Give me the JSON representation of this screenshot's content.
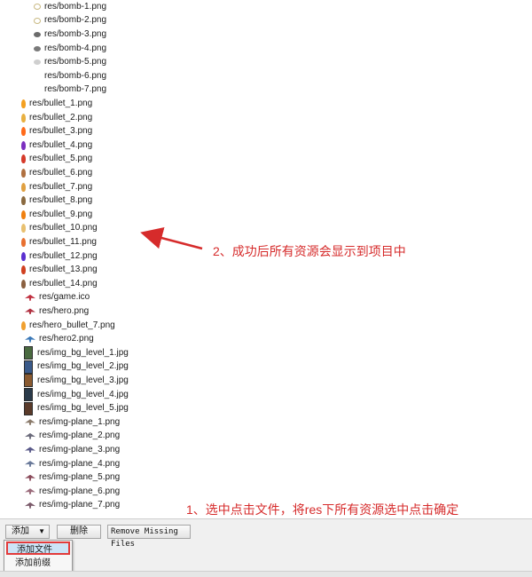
{
  "files": [
    {
      "name": "res/bomb-1.png",
      "icon": "bomb-ring",
      "color": "#c8b880"
    },
    {
      "name": "res/bomb-2.png",
      "icon": "bomb-ring",
      "color": "#c8b880"
    },
    {
      "name": "res/bomb-3.png",
      "icon": "bomb",
      "color": "#6b6b6b"
    },
    {
      "name": "res/bomb-4.png",
      "icon": "bomb",
      "color": "#7a7a7a"
    },
    {
      "name": "res/bomb-5.png",
      "icon": "bomb-light",
      "color": "#cfcfcf"
    },
    {
      "name": "res/bomb-6.png",
      "icon": "bomb-none",
      "color": "#ffffff"
    },
    {
      "name": "res/bomb-7.png",
      "icon": "bomb-none",
      "color": "#ffffff"
    },
    {
      "name": "res/bullet_1.png",
      "icon": "bullet",
      "color": "#f4a020"
    },
    {
      "name": "res/bullet_2.png",
      "icon": "bullet",
      "color": "#e8b040"
    },
    {
      "name": "res/bullet_3.png",
      "icon": "bullet",
      "color": "#ff6a1a"
    },
    {
      "name": "res/bullet_4.png",
      "icon": "bullet",
      "color": "#7b2fbf"
    },
    {
      "name": "res/bullet_5.png",
      "icon": "bullet",
      "color": "#d63a2a"
    },
    {
      "name": "res/bullet_6.png",
      "icon": "bullet",
      "color": "#b07040"
    },
    {
      "name": "res/bullet_7.png",
      "icon": "bullet",
      "color": "#e0a040"
    },
    {
      "name": "res/bullet_8.png",
      "icon": "bullet",
      "color": "#8a6a40"
    },
    {
      "name": "res/bullet_9.png",
      "icon": "bullet",
      "color": "#f08010"
    },
    {
      "name": "res/bullet_10.png",
      "icon": "bullet",
      "color": "#e8c070"
    },
    {
      "name": "res/bullet_11.png",
      "icon": "bullet",
      "color": "#e87030"
    },
    {
      "name": "res/bullet_12.png",
      "icon": "bullet",
      "color": "#5a2fd0"
    },
    {
      "name": "res/bullet_13.png",
      "icon": "bullet",
      "color": "#d04020"
    },
    {
      "name": "res/bullet_14.png",
      "icon": "bullet",
      "color": "#8a6040"
    },
    {
      "name": "res/game.ico",
      "icon": "ico",
      "color": "#c03040"
    },
    {
      "name": "res/hero.png",
      "icon": "plane",
      "color": "#b03040"
    },
    {
      "name": "res/hero_bullet_7.png",
      "icon": "bullet",
      "color": "#f0a030"
    },
    {
      "name": "res/hero2.png",
      "icon": "plane",
      "color": "#3a78b8"
    },
    {
      "name": "res/img_bg_level_1.jpg",
      "icon": "bg",
      "color": "#4a6a40"
    },
    {
      "name": "res/img_bg_level_2.jpg",
      "icon": "bg",
      "color": "#3a5a8a"
    },
    {
      "name": "res/img_bg_level_3.jpg",
      "icon": "bg",
      "color": "#8a5a30"
    },
    {
      "name": "res/img_bg_level_4.jpg",
      "icon": "bg",
      "color": "#2a3a4a"
    },
    {
      "name": "res/img_bg_level_5.jpg",
      "icon": "bg",
      "color": "#5a3a2a"
    },
    {
      "name": "res/img-plane_1.png",
      "icon": "plane",
      "color": "#8a7a6a"
    },
    {
      "name": "res/img-plane_2.png",
      "icon": "plane",
      "color": "#6a6a7a"
    },
    {
      "name": "res/img-plane_3.png",
      "icon": "plane",
      "color": "#5a5a8a"
    },
    {
      "name": "res/img-plane_4.png",
      "icon": "plane",
      "color": "#6a7a9a"
    },
    {
      "name": "res/img-plane_5.png",
      "icon": "plane",
      "color": "#8a4a5a"
    },
    {
      "name": "res/img-plane_6.png",
      "icon": "plane",
      "color": "#9a6a7a"
    },
    {
      "name": "res/img-plane_7.png",
      "icon": "plane",
      "color": "#7a5a6a"
    }
  ],
  "annotations": {
    "note_result": "2、成功后所有资源会显示到项目中",
    "note_step": "1、选中点击文件，将res下所有资源选中点击确定",
    "color": "#d62b2b"
  },
  "toolbar": {
    "add_label": "添加",
    "add_caret": "▼",
    "delete_label": "删除",
    "remove_missing_label": "Remove Missing Files"
  },
  "add_menu": {
    "items": [
      "添加文件",
      "添加前缀"
    ]
  }
}
